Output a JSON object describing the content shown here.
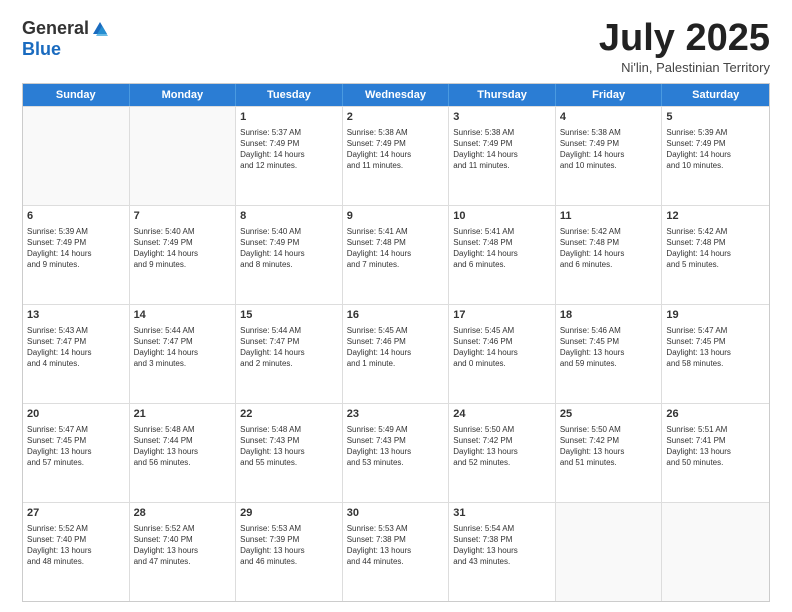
{
  "header": {
    "logo_general": "General",
    "logo_blue": "Blue",
    "month_title": "July 2025",
    "location": "Ni'lin, Palestinian Territory"
  },
  "weekdays": [
    "Sunday",
    "Monday",
    "Tuesday",
    "Wednesday",
    "Thursday",
    "Friday",
    "Saturday"
  ],
  "rows": [
    [
      {
        "day": "",
        "text": "",
        "empty": true
      },
      {
        "day": "",
        "text": "",
        "empty": true
      },
      {
        "day": "1",
        "text": "Sunrise: 5:37 AM\nSunset: 7:49 PM\nDaylight: 14 hours\nand 12 minutes."
      },
      {
        "day": "2",
        "text": "Sunrise: 5:38 AM\nSunset: 7:49 PM\nDaylight: 14 hours\nand 11 minutes."
      },
      {
        "day": "3",
        "text": "Sunrise: 5:38 AM\nSunset: 7:49 PM\nDaylight: 14 hours\nand 11 minutes."
      },
      {
        "day": "4",
        "text": "Sunrise: 5:38 AM\nSunset: 7:49 PM\nDaylight: 14 hours\nand 10 minutes."
      },
      {
        "day": "5",
        "text": "Sunrise: 5:39 AM\nSunset: 7:49 PM\nDaylight: 14 hours\nand 10 minutes."
      }
    ],
    [
      {
        "day": "6",
        "text": "Sunrise: 5:39 AM\nSunset: 7:49 PM\nDaylight: 14 hours\nand 9 minutes."
      },
      {
        "day": "7",
        "text": "Sunrise: 5:40 AM\nSunset: 7:49 PM\nDaylight: 14 hours\nand 9 minutes."
      },
      {
        "day": "8",
        "text": "Sunrise: 5:40 AM\nSunset: 7:49 PM\nDaylight: 14 hours\nand 8 minutes."
      },
      {
        "day": "9",
        "text": "Sunrise: 5:41 AM\nSunset: 7:48 PM\nDaylight: 14 hours\nand 7 minutes."
      },
      {
        "day": "10",
        "text": "Sunrise: 5:41 AM\nSunset: 7:48 PM\nDaylight: 14 hours\nand 6 minutes."
      },
      {
        "day": "11",
        "text": "Sunrise: 5:42 AM\nSunset: 7:48 PM\nDaylight: 14 hours\nand 6 minutes."
      },
      {
        "day": "12",
        "text": "Sunrise: 5:42 AM\nSunset: 7:48 PM\nDaylight: 14 hours\nand 5 minutes."
      }
    ],
    [
      {
        "day": "13",
        "text": "Sunrise: 5:43 AM\nSunset: 7:47 PM\nDaylight: 14 hours\nand 4 minutes."
      },
      {
        "day": "14",
        "text": "Sunrise: 5:44 AM\nSunset: 7:47 PM\nDaylight: 14 hours\nand 3 minutes."
      },
      {
        "day": "15",
        "text": "Sunrise: 5:44 AM\nSunset: 7:47 PM\nDaylight: 14 hours\nand 2 minutes."
      },
      {
        "day": "16",
        "text": "Sunrise: 5:45 AM\nSunset: 7:46 PM\nDaylight: 14 hours\nand 1 minute."
      },
      {
        "day": "17",
        "text": "Sunrise: 5:45 AM\nSunset: 7:46 PM\nDaylight: 14 hours\nand 0 minutes."
      },
      {
        "day": "18",
        "text": "Sunrise: 5:46 AM\nSunset: 7:45 PM\nDaylight: 13 hours\nand 59 minutes."
      },
      {
        "day": "19",
        "text": "Sunrise: 5:47 AM\nSunset: 7:45 PM\nDaylight: 13 hours\nand 58 minutes."
      }
    ],
    [
      {
        "day": "20",
        "text": "Sunrise: 5:47 AM\nSunset: 7:45 PM\nDaylight: 13 hours\nand 57 minutes."
      },
      {
        "day": "21",
        "text": "Sunrise: 5:48 AM\nSunset: 7:44 PM\nDaylight: 13 hours\nand 56 minutes."
      },
      {
        "day": "22",
        "text": "Sunrise: 5:48 AM\nSunset: 7:43 PM\nDaylight: 13 hours\nand 55 minutes."
      },
      {
        "day": "23",
        "text": "Sunrise: 5:49 AM\nSunset: 7:43 PM\nDaylight: 13 hours\nand 53 minutes."
      },
      {
        "day": "24",
        "text": "Sunrise: 5:50 AM\nSunset: 7:42 PM\nDaylight: 13 hours\nand 52 minutes."
      },
      {
        "day": "25",
        "text": "Sunrise: 5:50 AM\nSunset: 7:42 PM\nDaylight: 13 hours\nand 51 minutes."
      },
      {
        "day": "26",
        "text": "Sunrise: 5:51 AM\nSunset: 7:41 PM\nDaylight: 13 hours\nand 50 minutes."
      }
    ],
    [
      {
        "day": "27",
        "text": "Sunrise: 5:52 AM\nSunset: 7:40 PM\nDaylight: 13 hours\nand 48 minutes."
      },
      {
        "day": "28",
        "text": "Sunrise: 5:52 AM\nSunset: 7:40 PM\nDaylight: 13 hours\nand 47 minutes."
      },
      {
        "day": "29",
        "text": "Sunrise: 5:53 AM\nSunset: 7:39 PM\nDaylight: 13 hours\nand 46 minutes."
      },
      {
        "day": "30",
        "text": "Sunrise: 5:53 AM\nSunset: 7:38 PM\nDaylight: 13 hours\nand 44 minutes."
      },
      {
        "day": "31",
        "text": "Sunrise: 5:54 AM\nSunset: 7:38 PM\nDaylight: 13 hours\nand 43 minutes."
      },
      {
        "day": "",
        "text": "",
        "empty": true
      },
      {
        "day": "",
        "text": "",
        "empty": true
      }
    ]
  ]
}
